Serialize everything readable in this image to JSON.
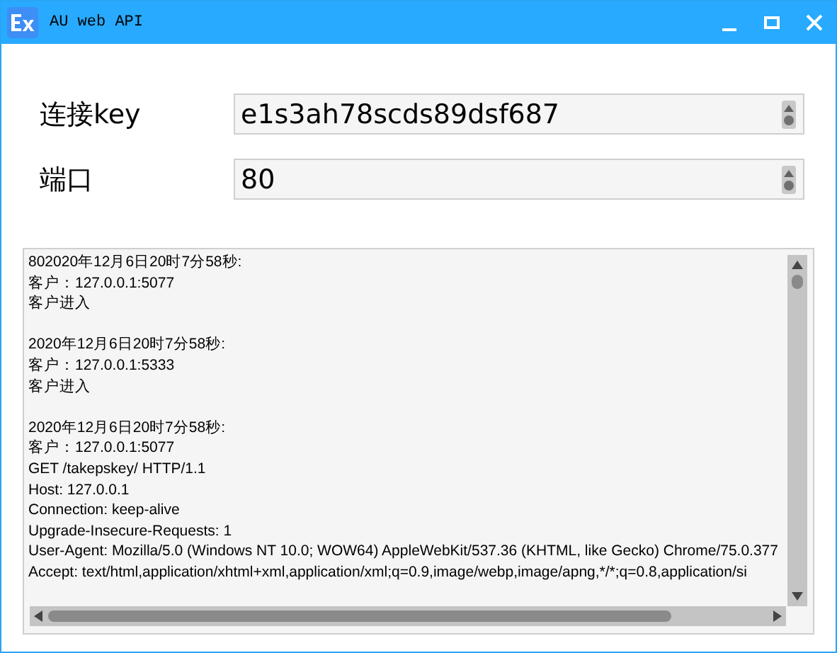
{
  "window": {
    "title": "AU web API"
  },
  "fields": [
    {
      "label": "连接key",
      "value": "e1s3ah78scds89dsf687"
    },
    {
      "label": "端口",
      "value": "80"
    }
  ],
  "log": {
    "blocks": [
      {
        "lines": [
          "802020年12月6日20时7分58秒:",
          "客户：127.0.0.1:5077",
          "客户进入"
        ]
      },
      {
        "lines": [
          "2020年12月6日20时7分58秒:",
          "客户：127.0.0.1:5333",
          "客户进入"
        ]
      },
      {
        "lines": [
          "2020年12月6日20时7分58秒:",
          "客户：127.0.0.1:5077",
          "GET /takepskey/ HTTP/1.1",
          "Host: 127.0.0.1",
          "Connection: keep-alive",
          "Upgrade-Insecure-Requests: 1",
          "User-Agent: Mozilla/5.0 (Windows NT 10.0; WOW64) AppleWebKit/537.36 (KHTML, like Gecko) Chrome/75.0.377",
          "Accept: text/html,application/xhtml+xml,application/xml;q=0.9,image/webp,image/apng,*/*;q=0.8,application/si"
        ]
      }
    ]
  }
}
